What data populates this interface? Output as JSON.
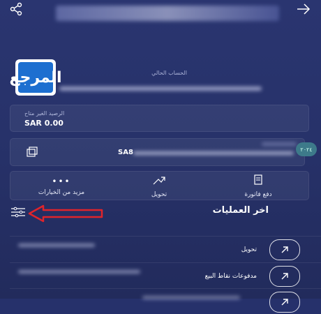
{
  "header": {
    "share_icon": "share-icon",
    "back_icon": "arrow-right-icon"
  },
  "logo": {
    "text": "المرجع"
  },
  "account": {
    "label": "الحساب الحالي"
  },
  "balance": {
    "label": "الرصيد الغير متاح",
    "value": "SAR 0.00"
  },
  "iban": {
    "prefix": "SA8",
    "badge": "٢٠٢٤"
  },
  "actions": [
    {
      "label": "دفع فاتورة",
      "icon": "bill-icon"
    },
    {
      "label": "تحويل",
      "icon": "transfer-icon"
    },
    {
      "label": "مزيد من الخيارات",
      "icon": "more-icon"
    }
  ],
  "operations": {
    "title": "اخر العمليات",
    "filter_icon": "filter-icon",
    "rows": [
      {
        "label": "تحويل",
        "icon": "arrow-up-right-icon"
      },
      {
        "label": "مدفوعات نقاط البيع",
        "icon": "arrow-up-right-icon"
      },
      {
        "label": "",
        "icon": "arrow-up-right-icon"
      }
    ]
  },
  "colors": {
    "background": "#26316b",
    "annotation": "#e0242b",
    "logo_blue": "#1d6fd0"
  }
}
